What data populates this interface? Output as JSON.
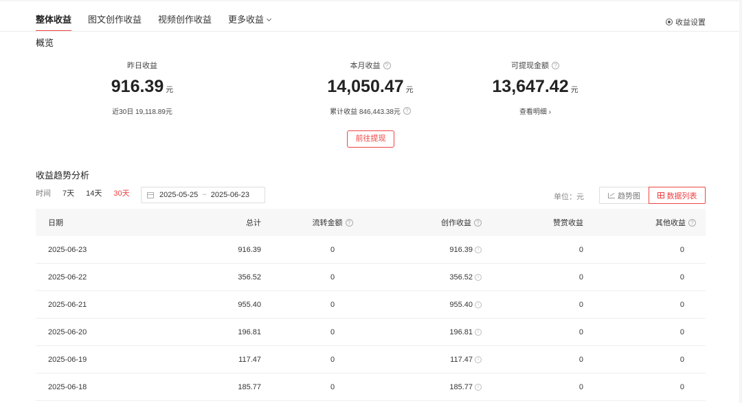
{
  "tabs": [
    {
      "label": "整体收益",
      "active": true
    },
    {
      "label": "图文创作收益",
      "active": false
    },
    {
      "label": "视频创作收益",
      "active": false
    },
    {
      "label": "更多收益",
      "active": false
    }
  ],
  "settings_label": "收益设置",
  "overview": {
    "title": "概览",
    "yesterday": {
      "label": "昨日收益",
      "value": "916.39",
      "unit": "元",
      "sub": "近30日 19,118.89元"
    },
    "month": {
      "label": "本月收益",
      "value": "14,050.47",
      "unit": "元",
      "sub": "累计收益 846,443.38元"
    },
    "withdrawable": {
      "label": "可提现金额",
      "value": "13,647.42",
      "unit": "元",
      "sub": "查看明细 ›"
    },
    "withdraw_button": "前往提现"
  },
  "trend": {
    "title": "收益趋势分析",
    "time_label": "时间",
    "ranges": [
      {
        "label": "7天",
        "active": false
      },
      {
        "label": "14天",
        "active": false
      },
      {
        "label": "30天",
        "active": true
      }
    ],
    "date_start": "2025-05-25",
    "date_sep": "~",
    "date_end": "2025-06-23",
    "unit_label": "单位：元",
    "view_trend": "趋势图",
    "view_list": "数据列表"
  },
  "table": {
    "headers": [
      "日期",
      "总计",
      "流转金额",
      "创作收益",
      "赞赏收益",
      "其他收益"
    ],
    "rows": [
      [
        "2025-06-23",
        "916.39",
        "0",
        "916.39",
        "0",
        "0"
      ],
      [
        "2025-06-22",
        "356.52",
        "0",
        "356.52",
        "0",
        "0"
      ],
      [
        "2025-06-21",
        "955.40",
        "0",
        "955.40",
        "0",
        "0"
      ],
      [
        "2025-06-20",
        "196.81",
        "0",
        "196.81",
        "0",
        "0"
      ],
      [
        "2025-06-19",
        "117.47",
        "0",
        "117.47",
        "0",
        "0"
      ],
      [
        "2025-06-18",
        "185.77",
        "0",
        "185.77",
        "0",
        "0"
      ]
    ]
  },
  "colors": {
    "accent": "#f04142",
    "header_bg": "#f7f7f7",
    "page_bg": "#f4f5f6"
  },
  "icons": [
    "chevron-down-icon",
    "settings-icon",
    "question-icon",
    "calendar-icon",
    "trend-chart-icon",
    "table-grid-icon",
    "info-icon"
  ]
}
